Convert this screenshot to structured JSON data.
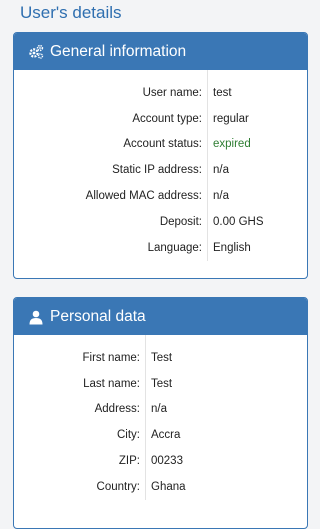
{
  "page": {
    "title": "User's details"
  },
  "general": {
    "title": "General information",
    "icon": "gears-icon",
    "rows": [
      {
        "label": "User name:",
        "value": "test"
      },
      {
        "label": "Account type:",
        "value": "regular"
      },
      {
        "label": "Account status:",
        "value": "expired"
      },
      {
        "label": "Static IP address:",
        "value": "n/a"
      },
      {
        "label": "Allowed MAC address:",
        "value": "n/a"
      },
      {
        "label": "Deposit:",
        "value": "0.00 GHS"
      },
      {
        "label": "Language:",
        "value": "English"
      }
    ]
  },
  "personal": {
    "title": "Personal data",
    "icon": "user-icon",
    "rows": [
      {
        "label": "First name:",
        "value": "Test"
      },
      {
        "label": "Last name:",
        "value": "Test"
      },
      {
        "label": "Address:",
        "value": "n/a"
      },
      {
        "label": "City:",
        "value": "Accra"
      },
      {
        "label": "ZIP:",
        "value": "00233"
      },
      {
        "label": "Country:",
        "value": "Ghana"
      }
    ]
  },
  "colors": {
    "accent": "#3a77b5",
    "status_expired": "#2e7d32",
    "title": "#2f6fb0"
  }
}
